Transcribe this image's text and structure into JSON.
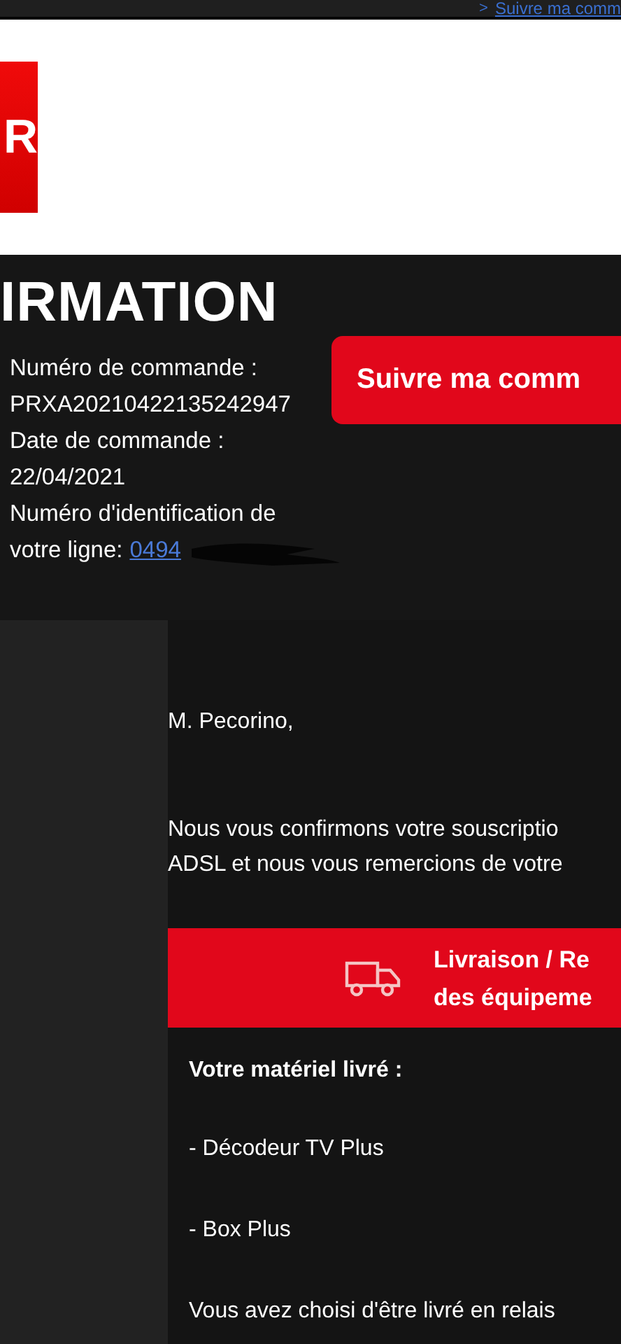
{
  "top_link": {
    "arrow": ">",
    "label": "Suivre ma comm"
  },
  "logo": {
    "letter": "R"
  },
  "title": "IRMATION",
  "order_info": [
    {
      "kind": "label",
      "text": "Numéro de commande :"
    },
    {
      "kind": "value",
      "text": "PRXA20210422135242947"
    },
    {
      "kind": "label",
      "text": "Date de commande :"
    },
    {
      "kind": "value",
      "text": "22/04/2021"
    },
    {
      "kind": "label",
      "text": "Numéro d'identification de"
    },
    {
      "kind": "line",
      "text": "votre ligne:",
      "link": "0494",
      "redacted": true
    }
  ],
  "track_button": {
    "label": "Suivre ma comm"
  },
  "greeting": "M. Pecorino,",
  "paragraph": [
    "Nous vous confirmons votre souscriptio",
    "ADSL et nous vous remercions de votre"
  ],
  "banner": {
    "lines": [
      "Livraison / Re",
      "des équipeme"
    ]
  },
  "equipment_heading": "Votre matériel livré :",
  "equipment": [
    "- Décodeur TV Plus",
    "- Box Plus"
  ],
  "delivery_note": "Vous avez choisi d'être livré en relais"
}
